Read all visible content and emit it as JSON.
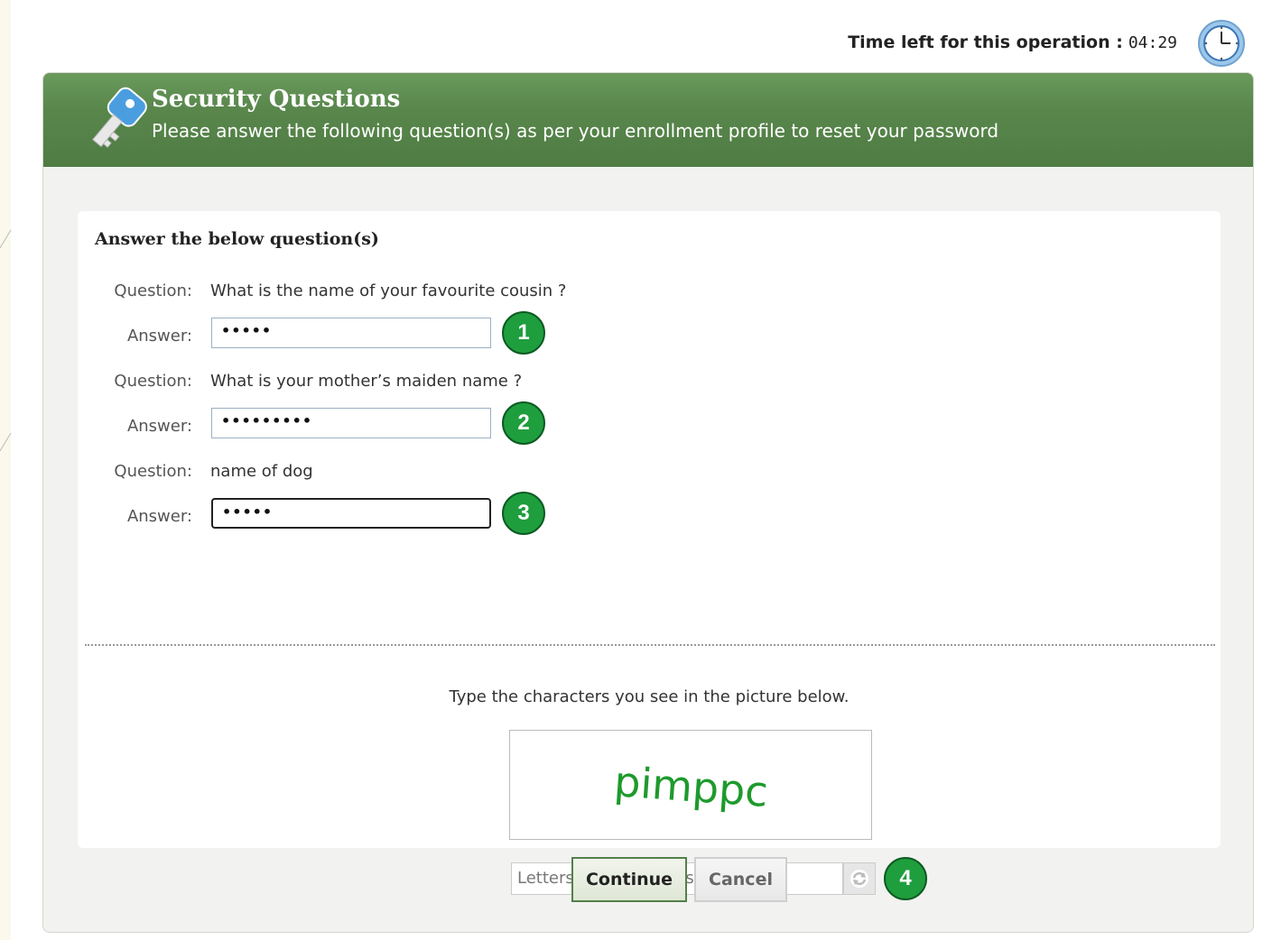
{
  "timer": {
    "label": "Time left for this operation :",
    "value": "04:29"
  },
  "header": {
    "title": "Security Questions",
    "subtitle": "Please answer the following question(s) as per your enrollment profile to reset your password"
  },
  "form": {
    "heading": "Answer the below question(s)",
    "question_label": "Question:",
    "answer_label": "Answer:",
    "questions": [
      {
        "text": "What is the name of your favourite cousin ?",
        "answer": "•••••",
        "badge": "1"
      },
      {
        "text": "What is your mother’s maiden name ?",
        "answer": "•••••••••",
        "badge": "2"
      },
      {
        "text": "name of dog",
        "answer": "•••••",
        "badge": "3"
      }
    ]
  },
  "captcha": {
    "instruction": "Type the characters you see in the picture below.",
    "image_text": "pimppc",
    "input_placeholder": "Letters are not case-sensitive",
    "badge": "4"
  },
  "buttons": {
    "continue": "Continue",
    "cancel": "Cancel"
  },
  "colors": {
    "header_green": "#58864b",
    "badge_green": "#1f9e3e",
    "captcha_green": "#1e9a2c"
  }
}
